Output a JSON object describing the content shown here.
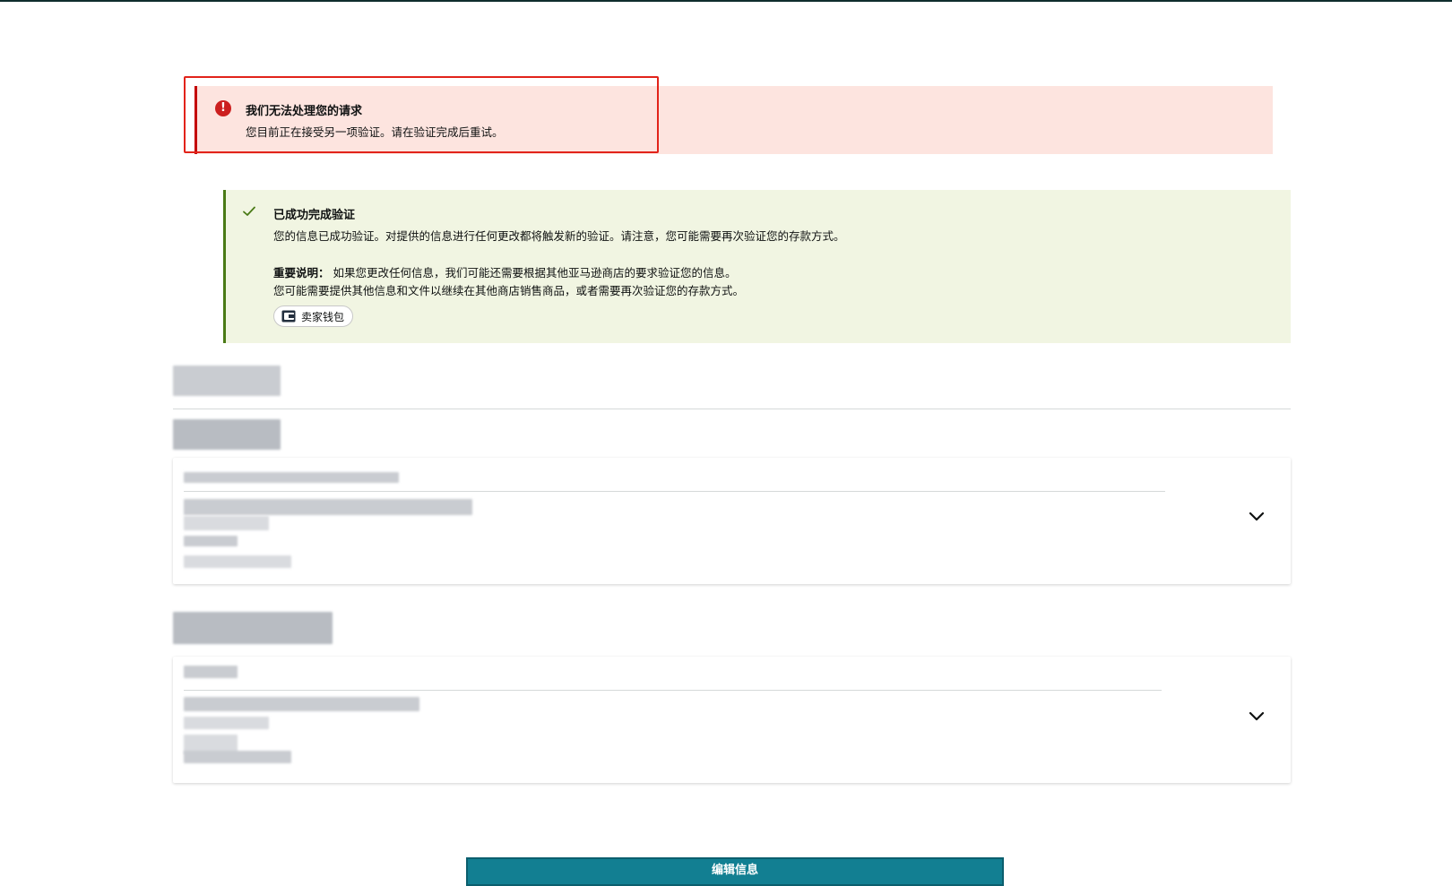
{
  "error_alert": {
    "title": "我们无法处理您的请求",
    "message": "您目前正在接受另一项验证。请在验证完成后重试。",
    "icon": "error-icon"
  },
  "success_alert": {
    "title": "已成功完成验证",
    "message": "您的信息已成功验证。对提供的信息进行任何更改都将触发新的验证。请注意，您可能需要再次验证您的存款方式。",
    "note_label": "重要说明：",
    "note_text": " 如果您更改任何信息，我们可能还需要根据其他亚马逊商店的要求验证您的信息。",
    "note_text2": "您可能需要提供其他信息和文件以继续在其他商店销售商品，或者需要再次验证您的存款方式。",
    "wallet_button": "卖家钱包",
    "icon": "check-icon"
  },
  "actions": {
    "edit_label": "编辑信息"
  },
  "colors": {
    "error_bg": "#fde4df",
    "error_accent": "#c40000",
    "success_bg": "#f1f5e2",
    "success_accent": "#4a7a16",
    "primary_button": "#127f92"
  }
}
